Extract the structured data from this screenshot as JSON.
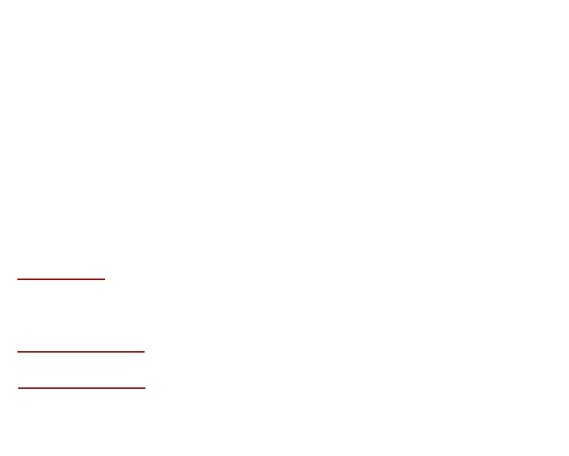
{
  "page": {
    "background_color": "#ffffff"
  },
  "rules": [
    {
      "id": "rule-1",
      "color": "#8b1a1a"
    },
    {
      "id": "rule-2",
      "color": "#8b1a1a"
    },
    {
      "id": "rule-3",
      "color": "#8b1a1a"
    }
  ]
}
